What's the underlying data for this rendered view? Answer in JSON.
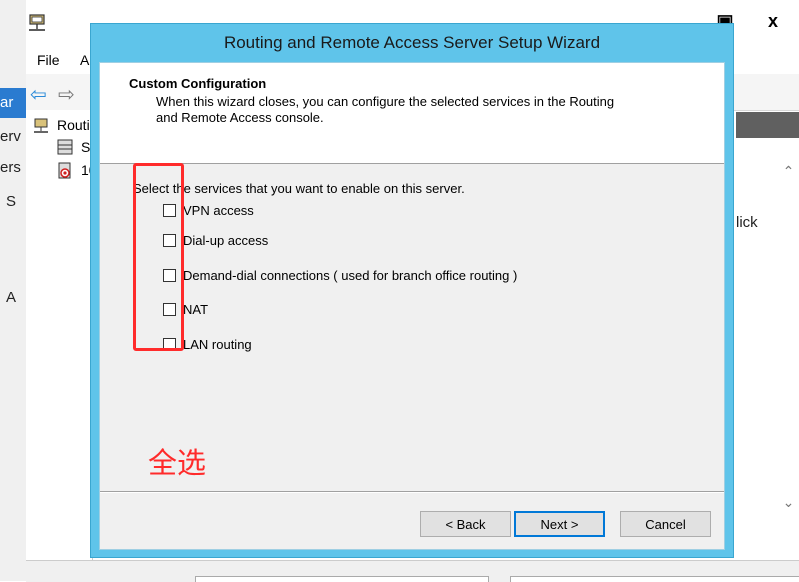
{
  "background_app": {
    "menu": [
      "File",
      "A"
    ],
    "tree_items": [
      "Routi",
      "Se",
      "10"
    ],
    "left_fragments": [
      "ar",
      "erv",
      "ers",
      "S",
      "A"
    ],
    "right_fragment": "lick",
    "window_controls": {
      "maximize": "▣",
      "close": "x"
    }
  },
  "wizard": {
    "title": "Routing and Remote Access Server Setup Wizard",
    "header_title": "Custom Configuration",
    "header_description": "When this wizard closes, you can configure the selected services in the Routing and Remote Access console.",
    "instruction": "Select the services that you want to enable on this server.",
    "options": [
      {
        "label": "VPN access",
        "checked": false
      },
      {
        "label": "Dial-up access",
        "checked": false
      },
      {
        "label": "Demand-dial connections ( used for branch office routing )",
        "checked": false
      },
      {
        "label": "NAT",
        "checked": false
      },
      {
        "label": "LAN routing",
        "checked": false
      }
    ],
    "buttons": {
      "back": "< Back",
      "next": "Next >",
      "cancel": "Cancel"
    }
  },
  "annotation": {
    "text": "全选",
    "color": "#ff2b2b"
  },
  "colors": {
    "wizard_frame": "#5fc4ea",
    "primary_button_border": "#0078d7"
  }
}
